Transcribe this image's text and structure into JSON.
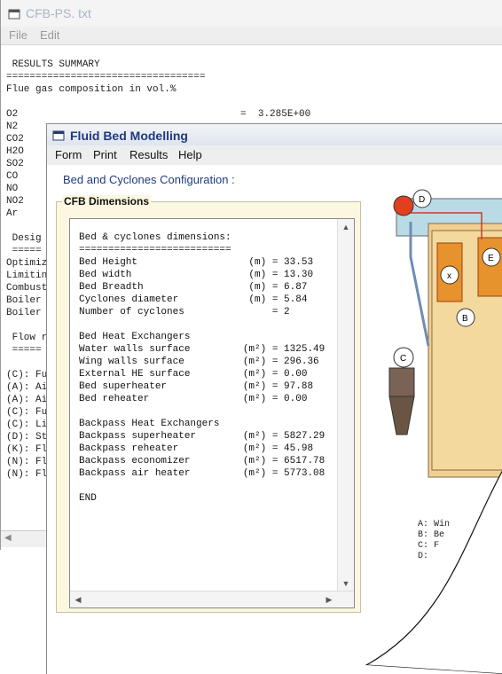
{
  "back_window": {
    "title": "CFB-PS. txt",
    "menu": [
      "File",
      "Edit"
    ],
    "text_lines": [
      " RESULTS SUMMARY",
      "==================================",
      "Flue gas composition in vol.%",
      "",
      "O2                                      =  3.285E+00",
      "N2",
      "CO2",
      "H2O",
      "SO2",
      "CO",
      "NO",
      "NO2",
      "Ar",
      "",
      " Desig",
      " =====",
      "Optimiz",
      "Limitin",
      "Combust",
      "Boiler",
      "Boiler",
      "",
      " Flow r",
      " =====",
      "",
      "(C): Fu",
      "(A): Ai",
      "(A): Ai",
      "(C): Fu",
      "(C): Li",
      "(D): St",
      "(K): Fl",
      "(N): Fl",
      "(N): Fl"
    ]
  },
  "front_window": {
    "title": "Fluid Bed Modelling",
    "menu": [
      "Form",
      "Print",
      "Results",
      "Help"
    ],
    "section_title": "Bed and Cyclones Configuration :",
    "group_title": "CFB Dimensions",
    "textbox_lines": [
      "Bed & cyclones dimensions:",
      "==========================",
      "Bed Height                   (m) = 33.53",
      "Bed width                    (m) = 13.30",
      "Bed Breadth                  (m) = 6.87",
      "Cyclones diameter            (m) = 5.84",
      "Number of cyclones               = 2",
      "",
      "Bed Heat Exchangers",
      "Water walls surface         (m²) = 1325.49",
      "Wing walls surface          (m²) = 296.36",
      "External HE surface         (m²) = 0.00",
      "Bed superheater             (m²) = 97.88",
      "Bed reheater                (m²) = 0.00",
      "",
      "Backpass Heat Exchangers",
      "Backpass superheater        (m²) = 5827.29",
      "Backpass reheater           (m²) = 45.98",
      "Backpass economizer         (m²) = 6517.78",
      "Backpass air heater         (m²) = 5773.08",
      "",
      "END"
    ],
    "diagram": {
      "markers": [
        "D",
        "E",
        "x",
        "B",
        "C"
      ],
      "legend": [
        "A: Win",
        "B: Be",
        "C: F",
        "D:"
      ]
    }
  }
}
